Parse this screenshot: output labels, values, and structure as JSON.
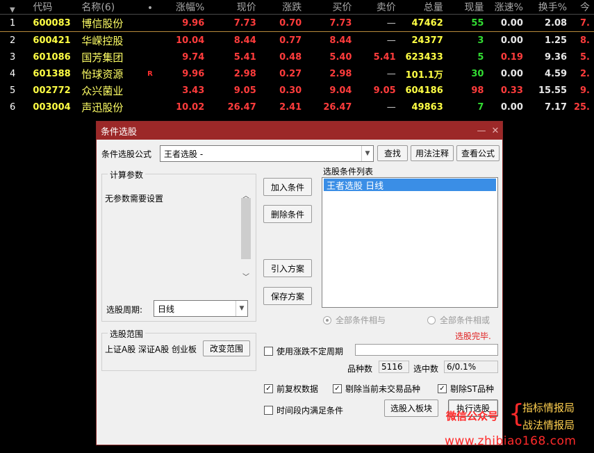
{
  "table": {
    "headers": [
      "代码",
      "名称(6)",
      "•",
      "涨幅%",
      "现价",
      "涨跌",
      "买价",
      "卖价",
      "总量",
      "现量",
      "涨速%",
      "换手%",
      "今"
    ],
    "rows": [
      {
        "idx": "1",
        "code": "600083",
        "name": "博信股份",
        "flag": "",
        "chg_pct": "9.96",
        "price": "7.73",
        "chg": "0.70",
        "bid": "7.73",
        "ask": "—",
        "vol": "47462",
        "cur": "55",
        "speed": "0.00",
        "turnover": "2.08",
        "open": "7."
      },
      {
        "idx": "2",
        "code": "600421",
        "name": "华嵘控股",
        "flag": "",
        "chg_pct": "10.04",
        "price": "8.44",
        "chg": "0.77",
        "bid": "8.44",
        "ask": "—",
        "vol": "24377",
        "cur": "3",
        "speed": "0.00",
        "turnover": "1.25",
        "open": "8."
      },
      {
        "idx": "3",
        "code": "601086",
        "name": "国芳集团",
        "flag": "",
        "chg_pct": "9.74",
        "price": "5.41",
        "chg": "0.48",
        "bid": "5.40",
        "ask": "5.41",
        "vol": "623433",
        "cur": "5",
        "speed": "0.19",
        "turnover": "9.36",
        "open": "5."
      },
      {
        "idx": "4",
        "code": "601388",
        "name": "怡球资源",
        "flag": "R",
        "chg_pct": "9.96",
        "price": "2.98",
        "chg": "0.27",
        "bid": "2.98",
        "ask": "—",
        "vol": "101.1万",
        "cur": "30",
        "speed": "0.00",
        "turnover": "4.59",
        "open": "2."
      },
      {
        "idx": "5",
        "code": "002772",
        "name": "众兴菌业",
        "flag": "",
        "chg_pct": "3.43",
        "price": "9.05",
        "chg": "0.30",
        "bid": "9.04",
        "ask": "9.05",
        "vol": "604186",
        "cur": "98",
        "speed": "0.33",
        "turnover": "15.55",
        "open": "9."
      },
      {
        "idx": "6",
        "code": "003004",
        "name": "声迅股份",
        "flag": "",
        "chg_pct": "10.02",
        "price": "26.47",
        "chg": "2.41",
        "bid": "26.47",
        "ask": "—",
        "vol": "49863",
        "cur": "7",
        "speed": "0.00",
        "turnover": "7.17",
        "open": "25."
      }
    ]
  },
  "dialog": {
    "title": "条件选股",
    "minimize": "—",
    "close": "✕",
    "formula_label": "条件选股公式",
    "formula_value": "王者选股  -",
    "btn_find": "查找",
    "btn_usage": "用法注释",
    "btn_view": "查看公式",
    "params_legend": "计算参数",
    "params_text": "无参数需要设置",
    "period_label": "选股周期:",
    "period_value": "日线",
    "btn_add": "加入条件",
    "btn_delete": "删除条件",
    "btn_import": "引入方案",
    "btn_save": "保存方案",
    "list_label": "选股条件列表",
    "list_items": [
      "王者选股  日线"
    ],
    "radio_and": "全部条件相与",
    "radio_or": "全部条件相或",
    "status": "选股完毕.",
    "range_legend": "选股范围",
    "range_text": "上证A股 深证A股 创业板",
    "btn_range": "改变范围",
    "chk_period": "使用涨跌不定周期",
    "count_label": "品种数",
    "count_value": "5116",
    "selected_label": "选中数",
    "selected_value": "6/0.1%",
    "chk_adjust": "前复权数据",
    "chk_exclude_untraded": "剔除当前未交易品种",
    "chk_exclude_st": "剔除ST品种",
    "chk_timespan": "时间段内满足条件",
    "btn_to_block": "选股入板块",
    "btn_execute": "执行选股"
  },
  "watermark": {
    "wechat": "微信公众号",
    "brace": "{",
    "line1": "指标情报局",
    "line2": "战法情报局",
    "url": "www.zhibiao168.com"
  }
}
